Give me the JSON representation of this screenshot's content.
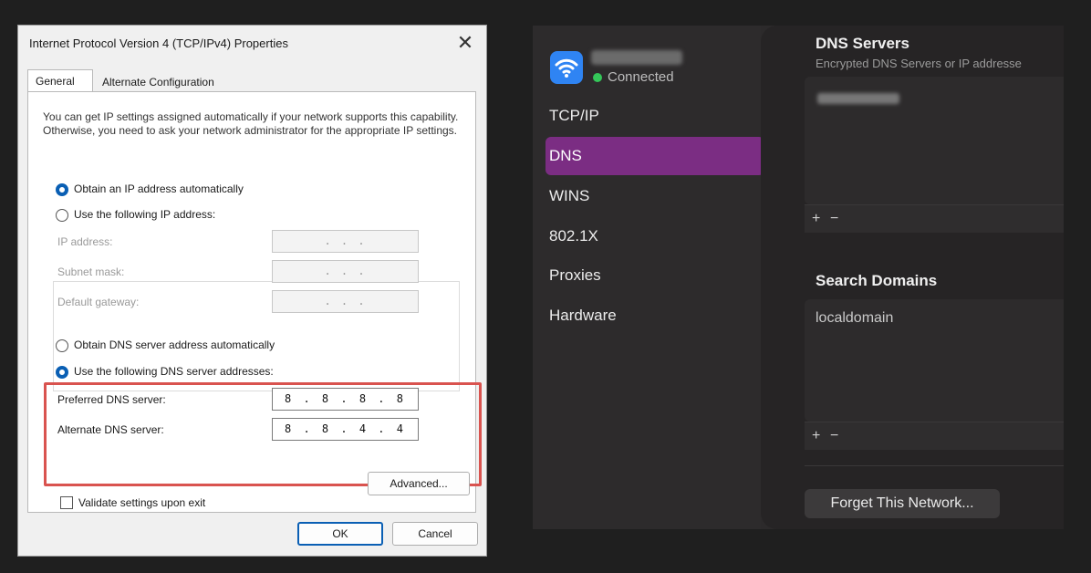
{
  "windows_dialog": {
    "title": "Internet Protocol Version 4 (TCP/IPv4) Properties",
    "close_glyph": "✕",
    "tabs": [
      "General",
      "Alternate Configuration"
    ],
    "description": "You can get IP settings assigned automatically if your network supports this capability. Otherwise, you need to ask your network administrator for the appropriate IP settings.",
    "ip_auto_label": "Obtain an IP address automatically",
    "ip_manual_label": "Use the following IP address:",
    "ip_fields": [
      {
        "label": "IP address:",
        "value": ".   .   ."
      },
      {
        "label": "Subnet mask:",
        "value": ".   .   ."
      },
      {
        "label": "Default gateway:",
        "value": ".   .   ."
      }
    ],
    "dns_auto_label": "Obtain DNS server address automatically",
    "dns_manual_label": "Use the following DNS server addresses:",
    "preferred_dns_label": "Preferred DNS server:",
    "preferred_dns_value": "8 . 8 . 8 . 8",
    "alternate_dns_label": "Alternate DNS server:",
    "alternate_dns_value": "8 . 8 . 4 . 4",
    "validate_label": "Validate settings upon exit",
    "advanced_label": "Advanced...",
    "ok_label": "OK",
    "cancel_label": "Cancel",
    "highlight_color": "#d9534f",
    "selected_radio_color": "#0a5fb4"
  },
  "mac_panel": {
    "status": "Connected",
    "icon": "wifi-icon",
    "nav": [
      "TCP/IP",
      "DNS",
      "WINS",
      "802.1X",
      "Proxies",
      "Hardware"
    ],
    "selected_nav": "DNS",
    "accent_color": "#7b2d83",
    "dns_servers_title": "DNS Servers",
    "dns_servers_subtitle": "Encrypted DNS Servers or IP addresse",
    "search_domains_title": "Search Domains",
    "search_domain_value": "localdomain",
    "add_glyph": "+",
    "remove_glyph": "−",
    "forget_button": "Forget This Network..."
  }
}
